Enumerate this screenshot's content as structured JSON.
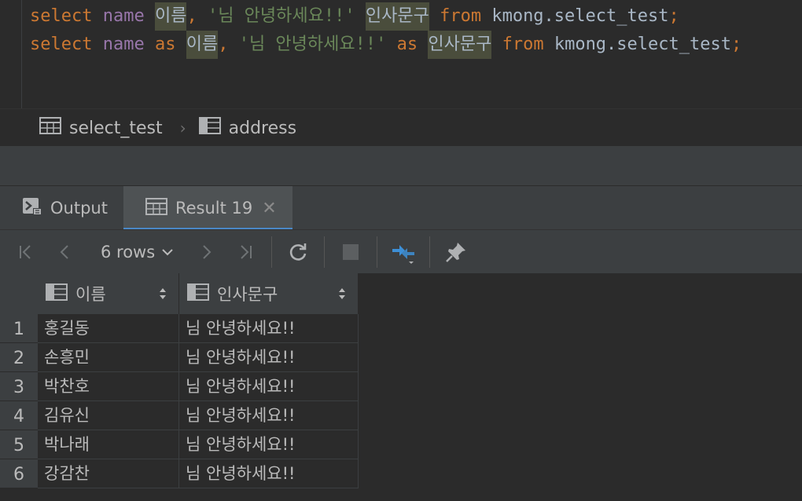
{
  "editor": {
    "line1": {
      "select": "select",
      "name": "name",
      "alias1": "이름",
      "comma": ",",
      "str": "'님 안녕하세요!!'",
      "alias2": "인사문구",
      "from": "from",
      "table": "kmong.select_test",
      "semi": ";"
    },
    "line2": {
      "select": "select",
      "name": "name",
      "as1": "as",
      "alias1": "이름",
      "comma": ",",
      "str": "'님 안녕하세요!!'",
      "as2": "as",
      "alias2": "인사문구",
      "from": "from",
      "table": "kmong.select_test",
      "semi": ";"
    }
  },
  "breadcrumb": {
    "items": [
      {
        "label": "select_test",
        "icon": "table-icon"
      },
      {
        "label": "address",
        "icon": "column-icon"
      }
    ],
    "separator": "›"
  },
  "tabs": [
    {
      "label": "Output",
      "icon": "console-icon",
      "active": false
    },
    {
      "label": "Result 19",
      "icon": "table-icon",
      "active": true,
      "close": "✕"
    }
  ],
  "toolbar": {
    "first": "|<",
    "prev": "<",
    "rows_label": "6 rows",
    "next": ">",
    "last": ">|"
  },
  "grid": {
    "columns": [
      "이름",
      "인사문구"
    ],
    "rows": [
      [
        "1",
        "홍길동",
        "님 안녕하세요!!"
      ],
      [
        "2",
        "손흥민",
        "님 안녕하세요!!"
      ],
      [
        "3",
        "박찬호",
        "님 안녕하세요!!"
      ],
      [
        "4",
        "김유신",
        "님 안녕하세요!!"
      ],
      [
        "5",
        "박나래",
        "님 안녕하세요!!"
      ],
      [
        "6",
        "강감찬",
        "님 안녕하세요!!"
      ]
    ]
  },
  "colors": {
    "accent": "#4a88c7",
    "keyword": "#cc7832",
    "string": "#6a8759",
    "function": "#9876aa"
  }
}
